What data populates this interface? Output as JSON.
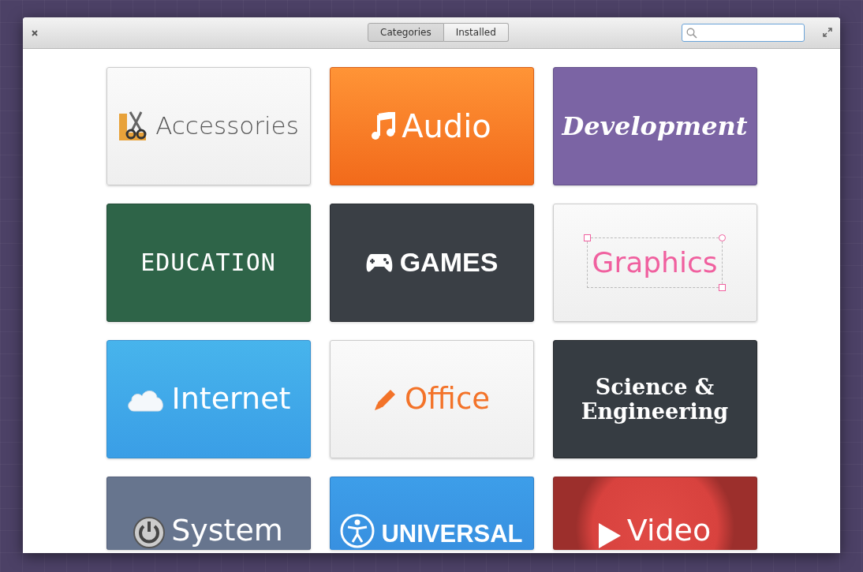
{
  "window": {
    "tabs": [
      {
        "label": "Categories",
        "selected": true
      },
      {
        "label": "Installed",
        "selected": false
      }
    ]
  },
  "categories": [
    {
      "label": "Accessories",
      "kind": "accessories"
    },
    {
      "label": "Audio",
      "kind": "audio"
    },
    {
      "label": "Development",
      "kind": "development"
    },
    {
      "label": "EDUCATION",
      "kind": "education"
    },
    {
      "label": "GAMES",
      "kind": "games"
    },
    {
      "label": "Graphics",
      "kind": "graphics"
    },
    {
      "label": "Internet",
      "kind": "internet"
    },
    {
      "label": "Office",
      "kind": "office"
    },
    {
      "label": "Science & Engineering",
      "kind": "science"
    },
    {
      "label": "System",
      "kind": "system"
    },
    {
      "label": "UNIVERSAL",
      "kind": "universal"
    },
    {
      "label": "Video",
      "kind": "video"
    }
  ]
}
